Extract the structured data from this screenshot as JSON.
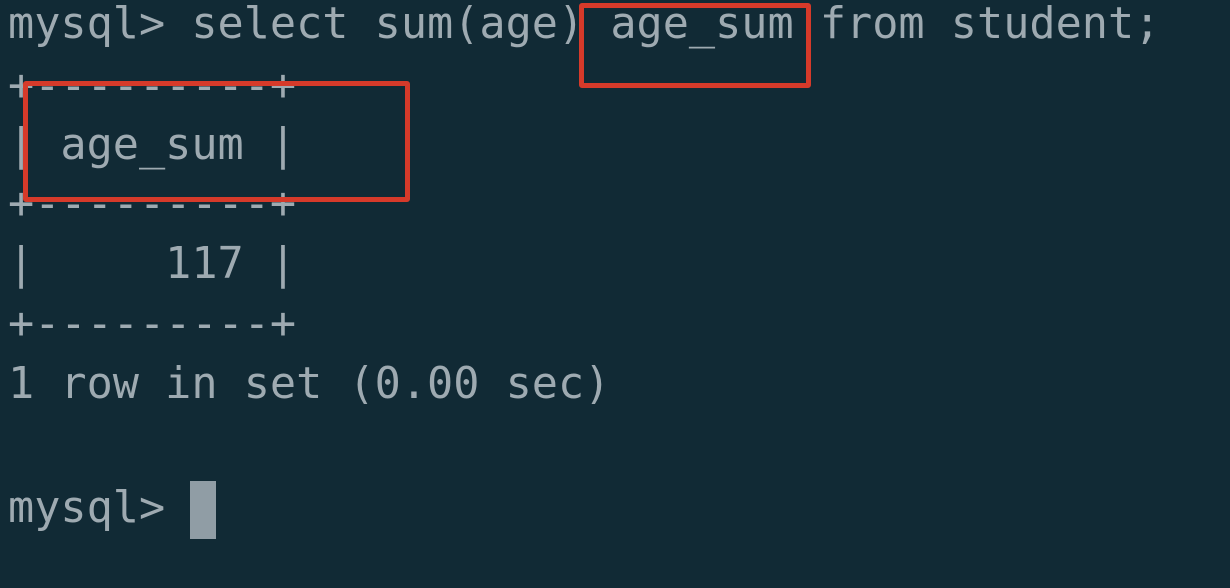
{
  "terminal": {
    "command_line": "mysql> select sum(age) age_sum from student;",
    "border_top": "+---------+",
    "header_row": "| age_sum |",
    "border_mid": "+---------+",
    "value_row": "|     117 |",
    "border_bottom": "+---------+",
    "result_summary": "1 row in set (0.00 sec)",
    "prompt": "mysql> "
  },
  "colors": {
    "background": "#112a35",
    "text": "#9eaab1",
    "highlight": "#d63a2a"
  },
  "annotations": [
    {
      "name": "alias-highlight-box",
      "target": "age_sum"
    },
    {
      "name": "column-header-highlight-box",
      "target": "age_sum"
    }
  ]
}
